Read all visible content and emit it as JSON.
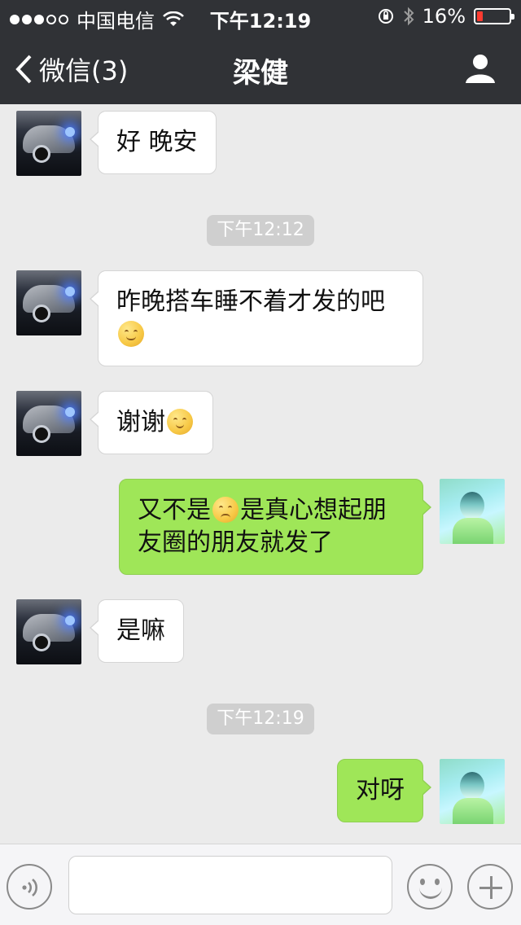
{
  "status_bar": {
    "carrier": "中国电信",
    "time": "下午12:19",
    "battery_percent": "16%"
  },
  "nav": {
    "back_label": "微信(3)",
    "title": "梁健"
  },
  "messages": [
    {
      "type": "in",
      "text": "好 晚安"
    },
    {
      "type": "timestamp",
      "text": "下午12:12"
    },
    {
      "type": "in",
      "text": "昨晚搭车睡不着才发的吧",
      "emoji": "tease-emoji"
    },
    {
      "type": "in",
      "text": "谢谢",
      "emoji": "blush-emoji"
    },
    {
      "type": "out",
      "text_a": "又不是",
      "emoji": "sad-emoji",
      "text_b": "是真心想起朋",
      "text_c": "友圈的朋友就发了"
    },
    {
      "type": "in",
      "text": "是嘛"
    },
    {
      "type": "timestamp",
      "text": "下午12:19"
    },
    {
      "type": "out",
      "text": "对呀"
    }
  ],
  "input": {
    "placeholder": ""
  },
  "colors": {
    "nav_bg": "#303236",
    "chat_bg": "#ebebeb",
    "out_bubble": "#9fe658",
    "in_bubble": "#ffffff",
    "battery_low": "#ff3b30"
  }
}
